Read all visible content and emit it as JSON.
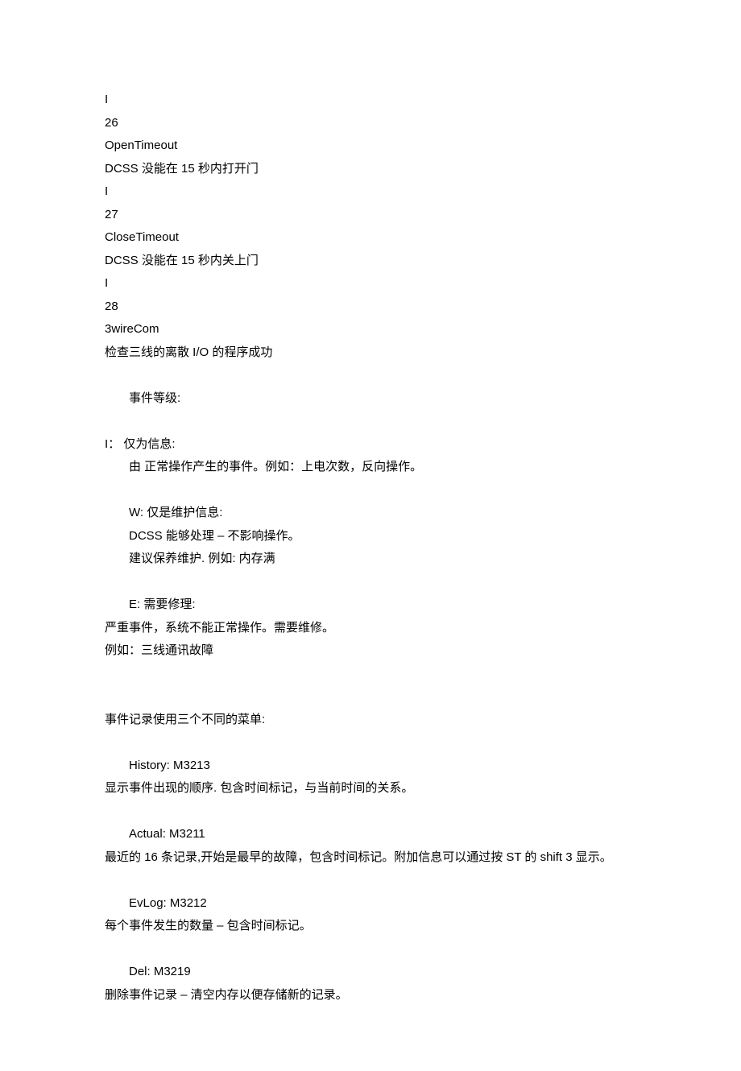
{
  "errors": [
    {
      "level": "I",
      "code": "26",
      "name": "OpenTimeout",
      "desc": "DCSS 没能在 15 秒内打开门"
    },
    {
      "level": "I",
      "code": "27",
      "name": "CloseTimeout",
      "desc": "DCSS  没能在 15 秒内关上门"
    },
    {
      "level": "I",
      "code": "28",
      "name": "3wireCom",
      "desc": "检查三线的离散 I/O 的程序成功"
    }
  ],
  "eventLevelHeading": "事件等级:",
  "levelI": {
    "title": "I： 仅为信息:",
    "desc": "由  正常操作产生的事件。例如：上电次数，反向操作。"
  },
  "levelW": {
    "title": "W: 仅是维护信息:",
    "line1": "DCSS 能够处理 – 不影响操作。",
    "line2": "建议保养维护. 例如: 内存满"
  },
  "levelE": {
    "title": "E: 需要修理:",
    "line1": "严重事件，系统不能正常操作。需要维修。",
    "line2": "例如：三线通讯故障"
  },
  "menusIntro": "事件记录使用三个不同的菜单:",
  "menus": [
    {
      "title": "History: M3213",
      "desc": "显示事件出现的顺序. 包含时间标记，与当前时间的关系。"
    },
    {
      "title": "Actual:  M3211",
      "desc": "最近的 16 条记录,开始是最早的故障，包含时间标记。附加信息可以通过按 ST 的  shift 3 显示。"
    },
    {
      "title": "EvLog:  M3212",
      "desc": "每个事件发生的数量 – 包含时间标记。"
    },
    {
      "title": "Del:  M3219",
      "desc": "删除事件记录 –    清空内存以便存储新的记录。"
    }
  ]
}
